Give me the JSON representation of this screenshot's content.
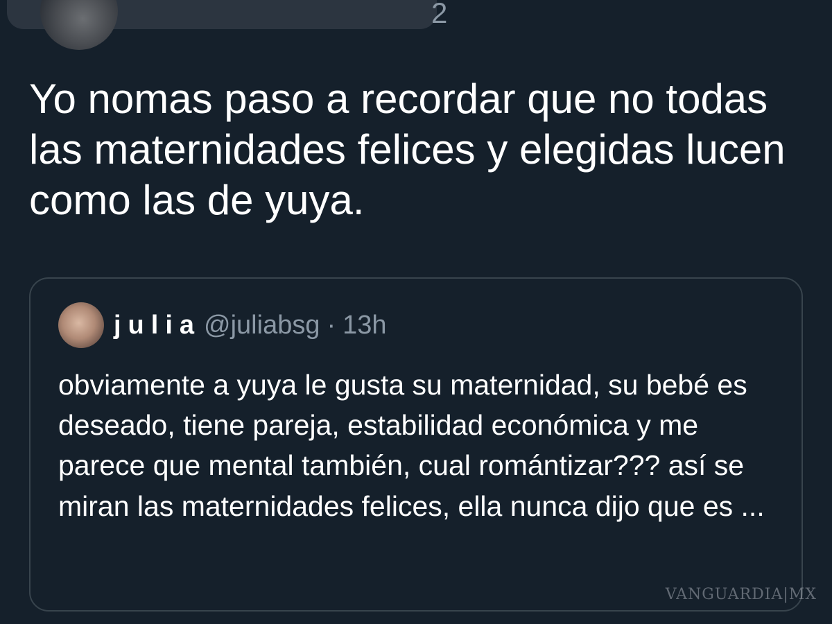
{
  "tweet": {
    "timestamp_fragment": "2",
    "text": "Yo nomas paso a recordar que no todas las maternidades felices y elegidas lucen como las de yuya."
  },
  "quoted_tweet": {
    "display_name": "julia",
    "handle": "@juliabsg",
    "separator": "·",
    "time": "13h",
    "text": "obviamente a yuya le gusta su maternidad, su bebé es deseado, tiene pareja, estabilidad económica y me parece que mental también, cual romántizar??? así se miran las maternidades felices, ella nunca dijo que es ..."
  },
  "watermark": "VANGUARDIA|MX"
}
